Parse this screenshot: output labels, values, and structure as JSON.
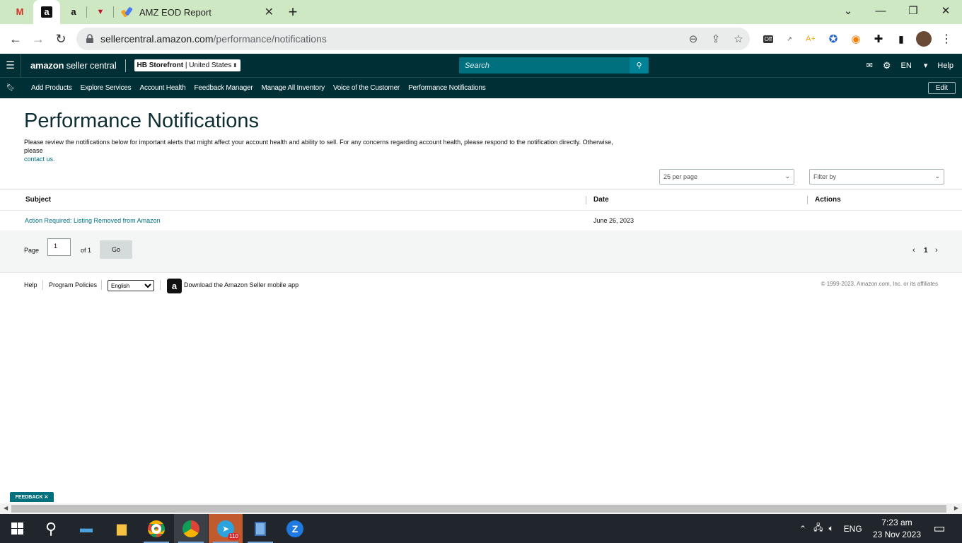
{
  "browser": {
    "tabs": [
      {
        "icon": "gmail-icon",
        "glyph": "M"
      },
      {
        "icon": "amazon-icon",
        "glyph": "a"
      },
      {
        "icon": "amazon-icon",
        "glyph": "a"
      },
      {
        "icon": "shield-icon",
        "glyph": "▼"
      }
    ],
    "active_tab_title": "AMZ EOD Report",
    "url_host": "sellercentral.amazon.com",
    "url_path": "/performance/notifications",
    "extension_off_label": "Off"
  },
  "header": {
    "logo_bold": "amazon",
    "logo_light": " seller central",
    "store_name": "HB Storefront",
    "store_region": "United States",
    "search_placeholder": "Search",
    "language": "EN",
    "help": "Help"
  },
  "nav": {
    "links": [
      "Add Products",
      "Explore Services",
      "Account Health",
      "Feedback Manager",
      "Manage All Inventory",
      "Voice of the Customer",
      "Performance Notifications"
    ],
    "edit_label": "Edit"
  },
  "page": {
    "title": "Performance Notifications",
    "description": "Please review the notifications below for important alerts that might affect your account health and ability to sell. For any concerns regarding account health, please respond to the notification directly. Otherwise, please",
    "contact_link": "contact us.",
    "per_page": "25 per page",
    "filter_placeholder": "Filter by"
  },
  "table": {
    "columns": [
      "Subject",
      "Date",
      "Actions"
    ],
    "rows": [
      {
        "subject": "Action Required: Listing Removed from Amazon",
        "date": "June 26, 2023",
        "actions": ""
      }
    ]
  },
  "pager": {
    "page_label": "Page",
    "page_value": "1",
    "of_label": "of 1",
    "go_label": "Go",
    "current": "1"
  },
  "footer": {
    "help": "Help",
    "policies": "Program Policies",
    "language": "English",
    "app_text": "Download the Amazon Seller mobile app",
    "copyright": "© 1999-2023, Amazon.com, Inc. or its affiliates"
  },
  "feedback_label": "FEEDBACK",
  "taskbar": {
    "lang": "ENG",
    "time": "7:23 am",
    "date": "23 Nov 2023",
    "telegram_badge": "110"
  },
  "colors": {
    "header_bg": "#002f36",
    "accent_teal": "#007185",
    "search_bg": "#00707e"
  }
}
